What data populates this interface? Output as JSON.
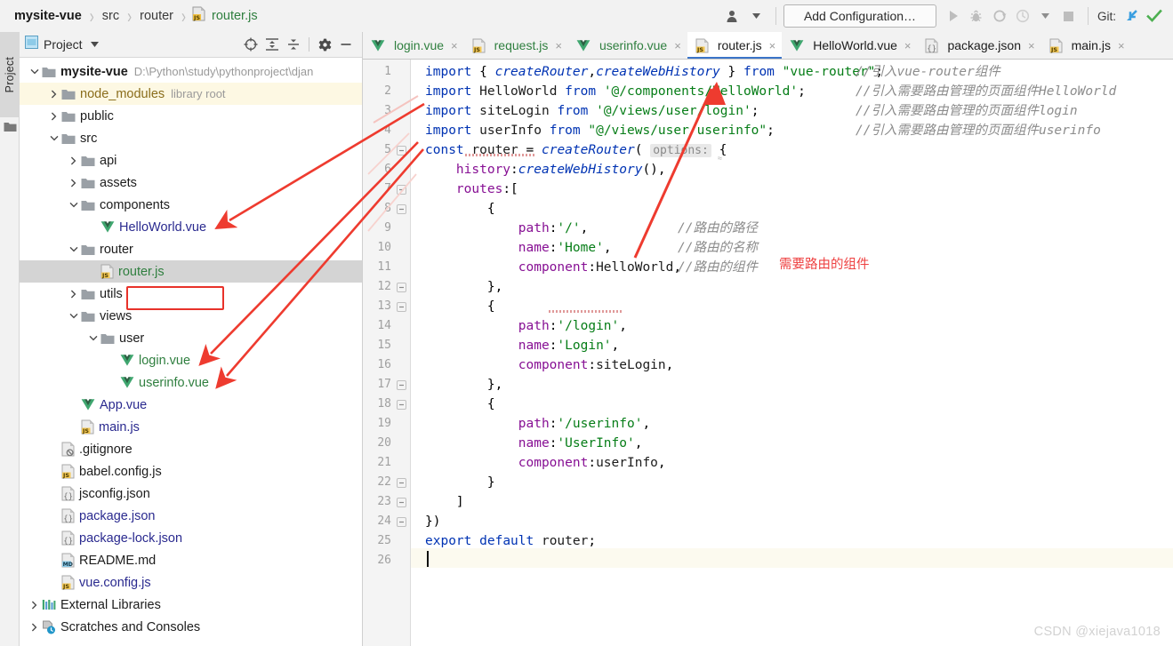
{
  "breadcrumb": {
    "project": "mysite-vue",
    "sep": "›",
    "items": [
      "src",
      "router"
    ],
    "file": "router.js"
  },
  "toolbar": {
    "user_icon": "user-profile-icon",
    "add_configuration": "Add Configuration…",
    "run_icon": "run-icon",
    "debug_icon": "debug-icon",
    "coverage_icon": "run-with-coverage-icon",
    "profile_icon": "profile-icon",
    "dropdown_icon": "chevron-down-icon",
    "stop_icon": "stop-icon",
    "git_label": "Git:",
    "git_update_icon": "git-update-project-icon",
    "git_commit_icon": "git-commit-icon"
  },
  "toolstrip": {
    "label": "Project",
    "folder_icon": "folder-icon"
  },
  "panel": {
    "title": "Project",
    "caret": "▾",
    "icons": [
      "locate-target-icon",
      "expand-all-icon",
      "collapse-all-icon",
      "settings-gear-icon",
      "hide-minus-icon"
    ]
  },
  "tree": [
    {
      "depth": 0,
      "arrow": "down",
      "icon": "folder-icon",
      "label": "mysite-vue",
      "style": "bold-dark",
      "sub": "D:\\Python\\study\\pythonproject\\djan",
      "row": "plain"
    },
    {
      "depth": 1,
      "arrow": "right",
      "icon": "folder-icon",
      "label": "node_modules",
      "style": "gold",
      "sub": "library root",
      "row": "yellow"
    },
    {
      "depth": 1,
      "arrow": "right",
      "icon": "folder-icon",
      "label": "public",
      "style": "dark",
      "sub": "",
      "row": "plain"
    },
    {
      "depth": 1,
      "arrow": "down",
      "icon": "folder-icon",
      "label": "src",
      "style": "dark",
      "sub": "",
      "row": "plain"
    },
    {
      "depth": 2,
      "arrow": "right",
      "icon": "folder-icon",
      "label": "api",
      "style": "dark",
      "sub": "",
      "row": "plain"
    },
    {
      "depth": 2,
      "arrow": "right",
      "icon": "folder-icon",
      "label": "assets",
      "style": "dark",
      "sub": "",
      "row": "plain"
    },
    {
      "depth": 2,
      "arrow": "down",
      "icon": "folder-icon",
      "label": "components",
      "style": "dark",
      "sub": "",
      "row": "plain"
    },
    {
      "depth": 3,
      "arrow": "none",
      "icon": "vue-file-icon",
      "label": "HelloWorld.vue",
      "style": "blue",
      "sub": "",
      "row": "plain"
    },
    {
      "depth": 2,
      "arrow": "down",
      "icon": "folder-icon",
      "label": "router",
      "style": "dark",
      "sub": "",
      "row": "plain"
    },
    {
      "depth": 3,
      "arrow": "none",
      "icon": "js-file-icon",
      "label": "router.js",
      "style": "green",
      "sub": "",
      "row": "selected"
    },
    {
      "depth": 2,
      "arrow": "right",
      "icon": "folder-icon",
      "label": "utils",
      "style": "dark",
      "sub": "",
      "row": "plain"
    },
    {
      "depth": 2,
      "arrow": "down",
      "icon": "folder-icon",
      "label": "views",
      "style": "dark",
      "sub": "",
      "row": "plain"
    },
    {
      "depth": 3,
      "arrow": "down",
      "icon": "folder-icon",
      "label": "user",
      "style": "dark",
      "sub": "",
      "row": "plain"
    },
    {
      "depth": 4,
      "arrow": "none",
      "icon": "vue-file-icon",
      "label": "login.vue",
      "style": "green",
      "sub": "",
      "row": "plain"
    },
    {
      "depth": 4,
      "arrow": "none",
      "icon": "vue-file-icon",
      "label": "userinfo.vue",
      "style": "green",
      "sub": "",
      "row": "plain"
    },
    {
      "depth": 2,
      "arrow": "none",
      "icon": "vue-file-icon",
      "label": "App.vue",
      "style": "blue",
      "sub": "",
      "row": "plain"
    },
    {
      "depth": 2,
      "arrow": "none",
      "icon": "js-file-icon",
      "label": "main.js",
      "style": "blue",
      "sub": "",
      "row": "plain"
    },
    {
      "depth": 1,
      "arrow": "none",
      "icon": "gitignore-icon",
      "label": ".gitignore",
      "style": "dark",
      "sub": "",
      "row": "plain"
    },
    {
      "depth": 1,
      "arrow": "none",
      "icon": "js-file-icon",
      "label": "babel.config.js",
      "style": "dark",
      "sub": "",
      "row": "plain"
    },
    {
      "depth": 1,
      "arrow": "none",
      "icon": "json-file-icon",
      "label": "jsconfig.json",
      "style": "dark",
      "sub": "",
      "row": "plain"
    },
    {
      "depth": 1,
      "arrow": "none",
      "icon": "json-file-icon",
      "label": "package.json",
      "style": "blue",
      "sub": "",
      "row": "plain"
    },
    {
      "depth": 1,
      "arrow": "none",
      "icon": "json-file-icon",
      "label": "package-lock.json",
      "style": "blue",
      "sub": "",
      "row": "plain"
    },
    {
      "depth": 1,
      "arrow": "none",
      "icon": "md-file-icon",
      "label": "README.md",
      "style": "dark",
      "sub": "",
      "row": "plain"
    },
    {
      "depth": 1,
      "arrow": "none",
      "icon": "js-file-icon",
      "label": "vue.config.js",
      "style": "blue",
      "sub": "",
      "row": "plain"
    },
    {
      "depth": 0,
      "arrow": "right",
      "icon": "libraries-icon",
      "label": "External Libraries",
      "style": "dark",
      "sub": "",
      "row": "plain"
    },
    {
      "depth": 0,
      "arrow": "right",
      "icon": "scratches-icon",
      "label": "Scratches and Consoles",
      "style": "dark",
      "sub": "",
      "row": "plain"
    }
  ],
  "tabs": [
    {
      "label": "login.vue",
      "icon": "vue-file-icon",
      "color": "green",
      "active": false,
      "close": "×"
    },
    {
      "label": "request.js",
      "icon": "js-file-icon",
      "color": "green",
      "active": false,
      "close": "×"
    },
    {
      "label": "userinfo.vue",
      "icon": "vue-file-icon",
      "color": "green",
      "active": false,
      "close": "×"
    },
    {
      "label": "router.js",
      "icon": "js-file-icon",
      "color": "dark",
      "active": true,
      "close": "×"
    },
    {
      "label": "HelloWorld.vue",
      "icon": "vue-file-icon",
      "color": "dark",
      "active": false,
      "close": "×"
    },
    {
      "label": "package.json",
      "icon": "json-file-icon",
      "color": "dark",
      "active": false,
      "close": "×"
    },
    {
      "label": "main.js",
      "icon": "js-file-icon",
      "color": "dark",
      "active": false,
      "close": "×"
    }
  ],
  "editor": {
    "line_numbers": [
      1,
      2,
      3,
      4,
      5,
      6,
      7,
      8,
      9,
      10,
      11,
      12,
      13,
      14,
      15,
      16,
      17,
      18,
      19,
      20,
      21,
      22,
      23,
      24,
      25,
      26
    ],
    "param_hint": "options:",
    "red_annotation": "需要路由的组件",
    "lines": [
      {
        "n": 1,
        "code": "import { createRouter,createWebHistory } from \"vue-router\";",
        "comment": "//引入vue-router组件"
      },
      {
        "n": 2,
        "code": "import HelloWorld from '@/components/HelloWorld';",
        "comment": "//引入需要路由管理的页面组件HelloWorld"
      },
      {
        "n": 3,
        "code": "import siteLogin from '@/views/user/login';",
        "comment": "//引入需要路由管理的页面组件login"
      },
      {
        "n": 4,
        "code": "import userInfo from \"@/views/user/userinfo\";",
        "comment": "//引入需要路由管理的页面组件userinfo"
      },
      {
        "n": 5,
        "code": "const router = createRouter( options: {",
        "comment": ""
      },
      {
        "n": 6,
        "code": "    history:createWebHistory(),",
        "comment": ""
      },
      {
        "n": 7,
        "code": "    routes:[",
        "comment": ""
      },
      {
        "n": 8,
        "code": "        {",
        "comment": ""
      },
      {
        "n": 9,
        "code": "            path:'/',",
        "comment": "//路由的路径"
      },
      {
        "n": 10,
        "code": "            name:'Home',",
        "comment": "//路由的名称"
      },
      {
        "n": 11,
        "code": "            component:HelloWorld,",
        "comment": "//路由的组件"
      },
      {
        "n": 12,
        "code": "        },",
        "comment": ""
      },
      {
        "n": 13,
        "code": "        {",
        "comment": ""
      },
      {
        "n": 14,
        "code": "            path:'/login',",
        "comment": ""
      },
      {
        "n": 15,
        "code": "            name:'Login',",
        "comment": ""
      },
      {
        "n": 16,
        "code": "            component:siteLogin,",
        "comment": ""
      },
      {
        "n": 17,
        "code": "        },",
        "comment": ""
      },
      {
        "n": 18,
        "code": "        {",
        "comment": ""
      },
      {
        "n": 19,
        "code": "            path:'/userinfo',",
        "comment": ""
      },
      {
        "n": 20,
        "code": "            name:'UserInfo',",
        "comment": ""
      },
      {
        "n": 21,
        "code": "            component:userInfo,",
        "comment": ""
      },
      {
        "n": 22,
        "code": "        }",
        "comment": ""
      },
      {
        "n": 23,
        "code": "    ]",
        "comment": ""
      },
      {
        "n": 24,
        "code": "})",
        "comment": ""
      },
      {
        "n": 25,
        "code": "export default router;",
        "comment": ""
      },
      {
        "n": 26,
        "code": "",
        "comment": ""
      }
    ]
  },
  "watermark": "CSDN @xiejava1018",
  "colors": {
    "accent_blue": "#3b75c9",
    "annotation_red": "#e8322a",
    "keyword": "#0033b3",
    "string": "#067d17",
    "property": "#871094",
    "comment": "#8c8c8c",
    "vue_green": "#41b883",
    "js_yellow": "#f0c040"
  }
}
